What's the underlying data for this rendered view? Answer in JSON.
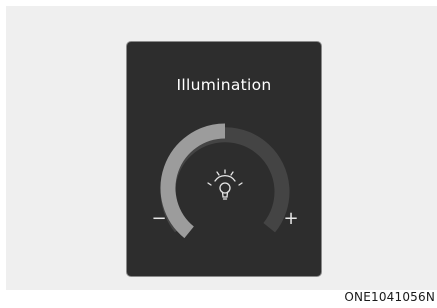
{
  "panel": {
    "title": "Illumination",
    "minus_label": "−",
    "plus_label": "+",
    "level": 0.5
  },
  "figure_code": "ONE1041056N",
  "colors": {
    "panel_bg": "#2d2d2d",
    "track": "#444444",
    "fill": "#9c9c9c",
    "stage_bg": "#efefef"
  },
  "icons": [
    "illumination-icon"
  ]
}
